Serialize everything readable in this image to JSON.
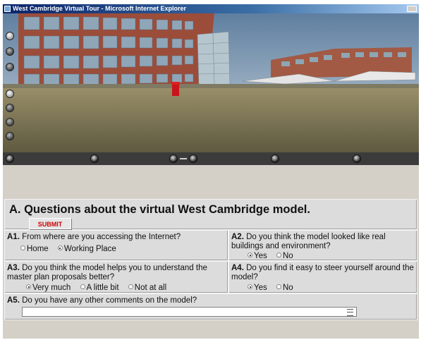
{
  "window": {
    "title": "West Cambridge Virtual Tour - Microsoft Internet Explorer"
  },
  "form": {
    "heading": "A. Questions about the virtual West Cambridge model.",
    "submit_label": "SUBMIT",
    "questions": [
      {
        "num": "A1.",
        "text": "From where are you accessing the Internet?",
        "options": [
          "Home",
          "Working Place"
        ],
        "selected": "Working Place"
      },
      {
        "num": "A2.",
        "text": "Do you think the model looked like real buildings and environment?",
        "options": [
          "Yes",
          "No"
        ],
        "selected": "Yes"
      },
      {
        "num": "A3.",
        "text": "Do you think the model helps you to understand the master plan proposals better?",
        "options": [
          "Very much",
          "A little bit",
          "Not at all"
        ],
        "selected": "Very much"
      },
      {
        "num": "A4.",
        "text": "Do you find it easy to steer yourself around the model?",
        "options": [
          "Yes",
          "No"
        ],
        "selected": "Yes"
      },
      {
        "num": "A5.",
        "text": "Do you have any other comments on the model?",
        "value": ""
      }
    ]
  }
}
